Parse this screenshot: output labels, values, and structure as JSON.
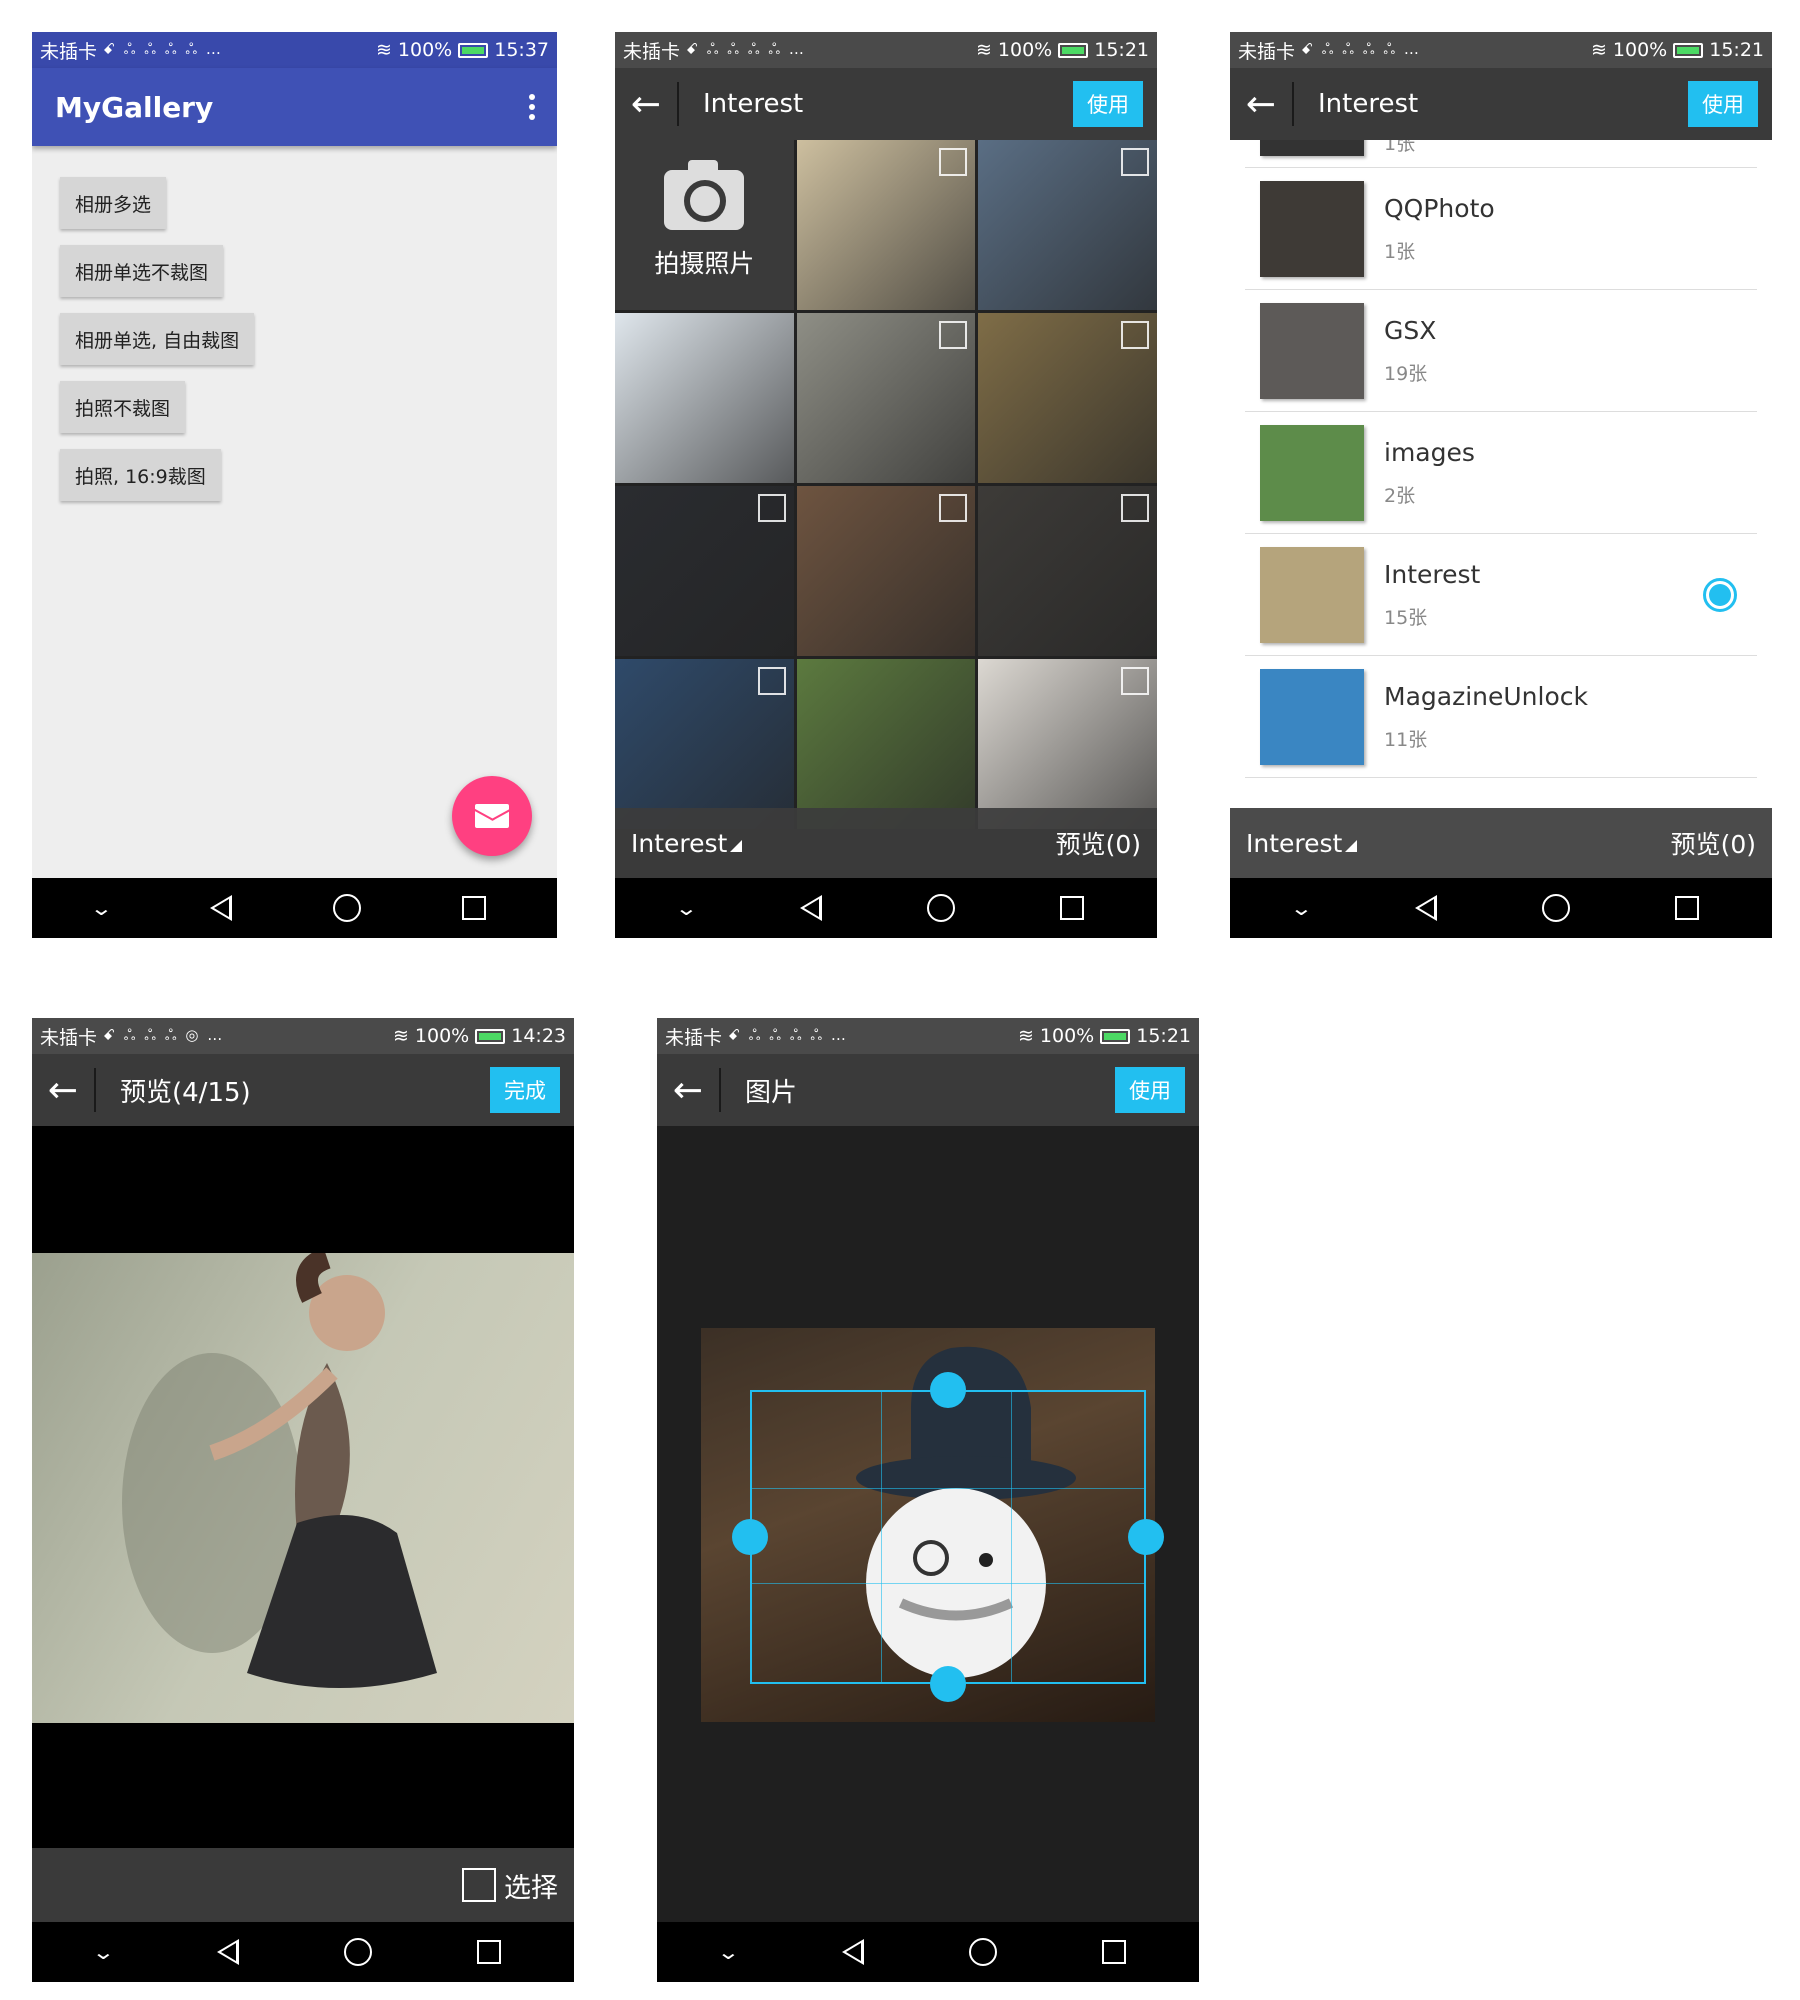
{
  "status_bars": [
    {
      "carrier": "未插卡",
      "icons": "ꗃ ஃ ஃ ஃ ஃ …",
      "battery": "100%",
      "time": "15:37"
    },
    {
      "carrier": "未插卡",
      "icons": "ꗃ ஃ ஃ ஃ ஃ …",
      "battery": "100%",
      "time": "15:21"
    },
    {
      "carrier": "未插卡",
      "icons": "ꗃ ஃ ஃ ஃ ஃ …",
      "battery": "100%",
      "time": "15:21"
    },
    {
      "carrier": "未插卡",
      "icons": "ꗃ ஃ ஃ ஃ ◎ …",
      "battery": "100%",
      "time": "14:23"
    },
    {
      "carrier": "未插卡",
      "icons": "ꗃ ஃ ஃ ஃ ஃ …",
      "battery": "100%",
      "time": "15:21"
    }
  ],
  "main": {
    "app_title": "MyGallery",
    "buttons": [
      "相册多选",
      "相册单选不裁图",
      "相册单选, 自由裁图",
      "拍照不裁图",
      "拍照, 16:9裁图"
    ]
  },
  "grid_screen": {
    "title": "Interest",
    "use_label": "使用",
    "camera_label": "拍摄照片",
    "folder_label": "Interest",
    "preview_label": "预览(0)",
    "thumb_colors": [
      "#cdbf9f",
      "#5a6e84",
      "#dfe6ec",
      "#8f8f86",
      "#7f6d47",
      "#2a2c30",
      "#6e5440",
      "#3d3b38",
      "#2f4a6a",
      "#5c7a3f",
      "#dcd8d2"
    ]
  },
  "album_screen": {
    "title": "Interest",
    "use_label": "使用",
    "partial_count": "1张",
    "albums": [
      {
        "name": "QQPhoto",
        "count": "1张",
        "color": "#3e3a36",
        "selected": false
      },
      {
        "name": "GSX",
        "count": "19张",
        "color": "#5d5a58",
        "selected": false
      },
      {
        "name": "images",
        "count": "2张",
        "color": "#5d8c4a",
        "selected": false
      },
      {
        "name": "Interest",
        "count": "15张",
        "color": "#b5a47c",
        "selected": true
      },
      {
        "name": "MagazineUnlock",
        "count": "11张",
        "color": "#3a86c2",
        "selected": false
      }
    ],
    "folder_label": "Interest",
    "preview_label": "预览(0)"
  },
  "preview_screen": {
    "title": "预览(4/15)",
    "done_label": "完成",
    "select_label": "选择"
  },
  "crop_screen": {
    "title": "图片",
    "use_label": "使用"
  },
  "colors": {
    "primary": "#3f51b5",
    "accent": "#ff4081",
    "action": "#22bff0"
  }
}
